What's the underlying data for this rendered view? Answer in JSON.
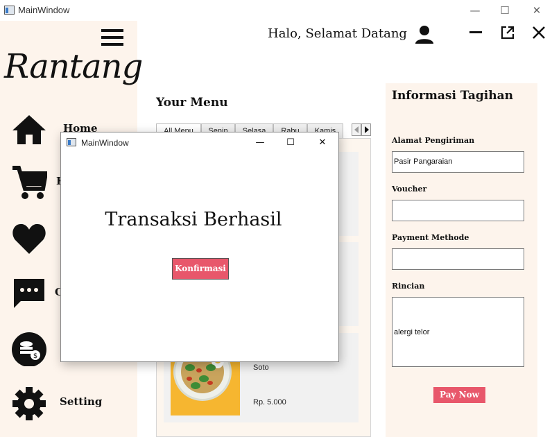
{
  "window": {
    "title": "MainWindow"
  },
  "sidebar": {
    "logo": "Rantang",
    "items": [
      {
        "label": "Home",
        "icon": "home-icon"
      },
      {
        "label": "K",
        "icon": "cart-icon"
      },
      {
        "label": "",
        "icon": "heart-icon"
      },
      {
        "label": "C",
        "icon": "chat-icon"
      },
      {
        "label": "",
        "icon": "coins-icon"
      },
      {
        "label": "Setting",
        "icon": "gear-icon"
      }
    ]
  },
  "header": {
    "greeting": "Halo, Selamat Datang"
  },
  "menu": {
    "title": "Your Menu",
    "tabs": [
      "All Menu",
      "Senin",
      "Selasa",
      "Rabu",
      "Kamis"
    ],
    "item": {
      "name": "Soto",
      "price": "Rp. 5.000"
    }
  },
  "billing": {
    "title": "Informasi Tagihan",
    "address_label": "Alamat Pengiriman",
    "address_value": "Pasir Pangaraian",
    "voucher_label": "Voucher",
    "voucher_value": "",
    "payment_label": "Payment Methode",
    "payment_value": "",
    "details_label": "Rincian",
    "details_value": "alergi telor",
    "pay_button": "Pay Now"
  },
  "dialog": {
    "title": "MainWindow",
    "message": "Transaksi Berhasil",
    "confirm_button": "Konfirmasi"
  },
  "colors": {
    "accent": "#e8576b",
    "panel_bg": "#fdf4ec",
    "card_bg": "#f1f1f1"
  }
}
